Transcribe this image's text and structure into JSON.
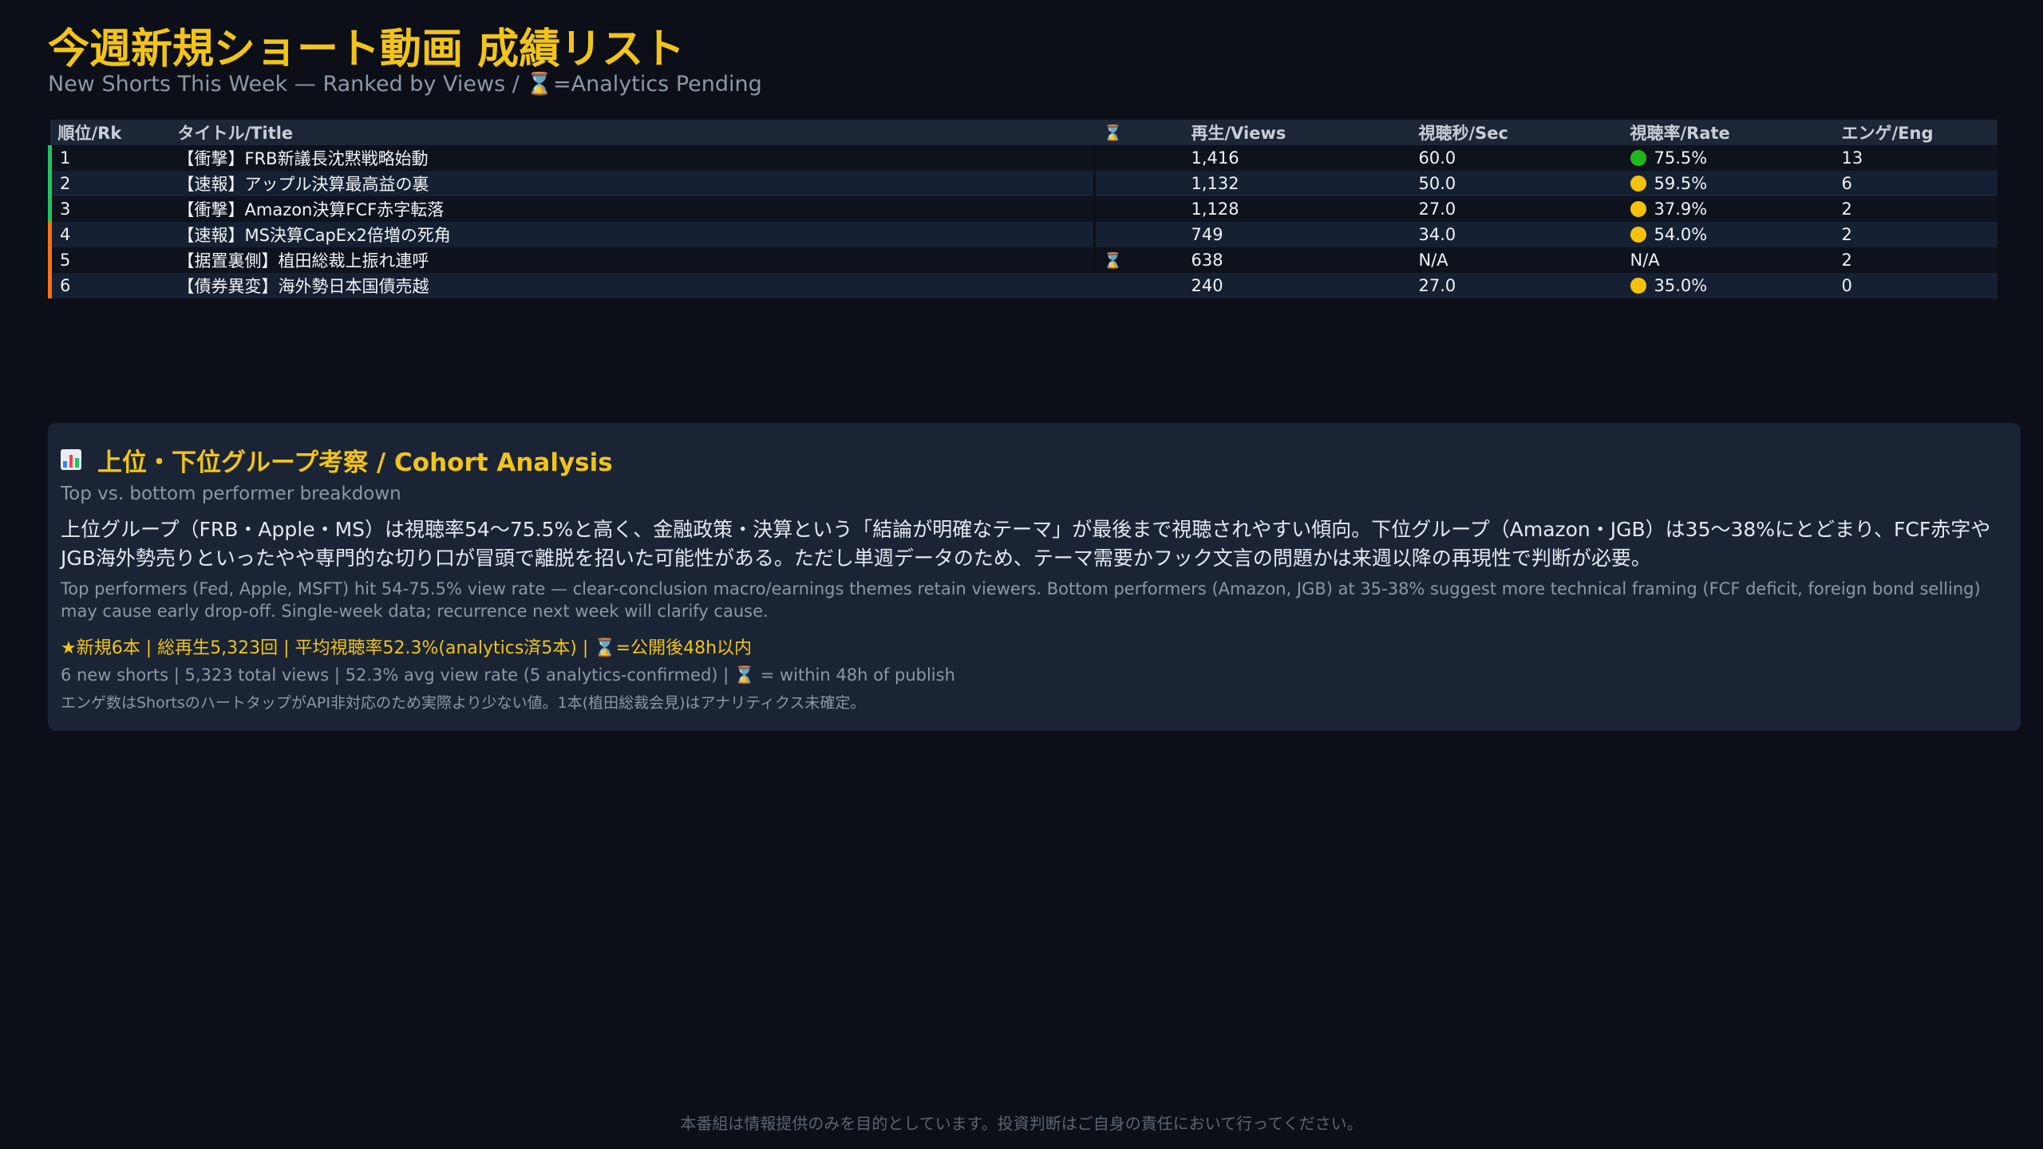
{
  "header": {
    "title": "今週新規ショート動画 成績リスト",
    "subtitle": "New Shorts This Week — Ranked by Views / ⌛=Analytics Pending"
  },
  "table": {
    "columns": [
      "順位/Rk",
      "タイトル/Title",
      "⌛",
      "再生/Views",
      "視聴秒/Sec",
      "視聴率/Rate",
      "エンゲ/Eng"
    ],
    "rows": [
      {
        "rank": "1",
        "title": "【衝撃】FRB新議長沈黙戦略始動",
        "pending": "",
        "views": "1,416",
        "sec": "60.0",
        "rate": "75.5%",
        "rate_color": "#1fb81f",
        "eng": "13",
        "group": "top"
      },
      {
        "rank": "2",
        "title": "【速報】アップル決算最高益の裏",
        "pending": "",
        "views": "1,132",
        "sec": "50.0",
        "rate": "59.5%",
        "rate_color": "#f4c20d",
        "eng": "6",
        "group": "top"
      },
      {
        "rank": "3",
        "title": "【衝撃】Amazon決算FCF赤字転落",
        "pending": "",
        "views": "1,128",
        "sec": "27.0",
        "rate": "37.9%",
        "rate_color": "#f4c20d",
        "eng": "2",
        "group": "top"
      },
      {
        "rank": "4",
        "title": "【速報】MS決算CapEx2倍増の死角",
        "pending": "",
        "views": "749",
        "sec": "34.0",
        "rate": "54.0%",
        "rate_color": "#f4c20d",
        "eng": "2",
        "group": "bottom"
      },
      {
        "rank": "5",
        "title": "【据置裏側】植田総裁上振れ連呼",
        "pending": "⌛",
        "views": "638",
        "sec": "N/A",
        "rate": "N/A",
        "rate_color": "",
        "eng": "2",
        "group": "bottom"
      },
      {
        "rank": "6",
        "title": "【債券異変】海外勢日本国債売越",
        "pending": "",
        "views": "240",
        "sec": "27.0",
        "rate": "35.0%",
        "rate_color": "#f4c20d",
        "eng": "0",
        "group": "bottom"
      }
    ]
  },
  "colors": {
    "top_group": "#22c55e",
    "bottom_group": "#f97316",
    "accent": "#f2c41a"
  },
  "panel": {
    "icon": "bar-chart-icon",
    "title": "上位・下位グループ考察 / Cohort Analysis",
    "subtitle": "Top vs. bottom performer breakdown",
    "body_ja": "上位グループ（FRB・Apple・MS）は視聴率54〜75.5%と高く、金融政策・決算という「結論が明確なテーマ」が最後まで視聴されやすい傾向。下位グループ（Amazon・JGB）は35〜38%にとどまり、FCF赤字やJGB海外勢売りといったやや専門的な切り口が冒頭で離脱を招いた可能性がある。ただし単週データのため、テーマ需要かフック文言の問題かは来週以降の再現性で判断が必要。",
    "body_en": "Top performers (Fed, Apple, MSFT) hit 54-75.5% view rate — clear-conclusion macro/earnings themes retain viewers. Bottom performers (Amazon, JGB) at 35-38% suggest more technical framing (FCF deficit, foreign bond selling) may cause early drop-off. Single-week data; recurrence next week will clarify cause.",
    "stats_ja": "★新規6本 | 総再生5,323回 | 平均視聴率52.3%(analytics済5本) | ⌛=公開後48h以内",
    "stats_en": "6 new shorts | 5,323 total views | 52.3% avg view rate (5 analytics-confirmed) | ⌛ = within 48h of publish",
    "note": "エンゲ数はShortsのハートタップがAPI非対応のため実際より少ない値。1本(植田総裁会見)はアナリティクス未確定。"
  },
  "footer": {
    "disclaimer": "本番組は情報提供のみを目的としています。投資判断はご自身の責任において行ってください。"
  }
}
